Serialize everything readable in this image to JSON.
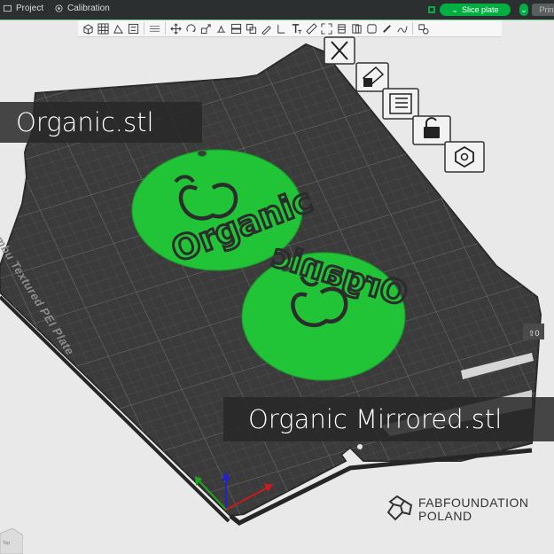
{
  "topbar": {
    "tab_project": "Project",
    "tab_calibration": "Calibration",
    "slice_button": "Slice plate",
    "print_button": "Print pla"
  },
  "toolbar": {
    "icons": [
      "add-cube-icon",
      "grid-icon",
      "auto-orient-icon",
      "arrange-icon",
      "layers-icon",
      "move-icon",
      "rotate-icon",
      "scale-icon",
      "lay-on-face-icon",
      "cut-icon",
      "mesh-boolean-icon",
      "support-paint-icon",
      "seam-paint-icon",
      "text-icon",
      "measure-icon",
      "assembly-icon",
      "variable-layer-icon",
      "split-objects-icon",
      "split-parts-icon",
      "paint-icon",
      "fuzzy-icon",
      "settings-icon"
    ]
  },
  "labels": {
    "left": "Organic.stl",
    "right": "Organic Mirrored.stl"
  },
  "plate": {
    "name": "Bambu Textured PEI Plate",
    "coin_text": "Organic"
  },
  "side_buttons": [
    "close-plate-icon",
    "auto-orient-plate-icon",
    "arrange-plate-icon",
    "lock-plate-icon",
    "plate-settings-icon"
  ],
  "logo": {
    "line1": "FABFOUNDATION",
    "line2": "POLAND"
  },
  "colors": {
    "accent": "#00ae42",
    "model": "#22c437",
    "plate": "#3d3d3d",
    "grid": "#575757",
    "label_bg": "#282828"
  }
}
